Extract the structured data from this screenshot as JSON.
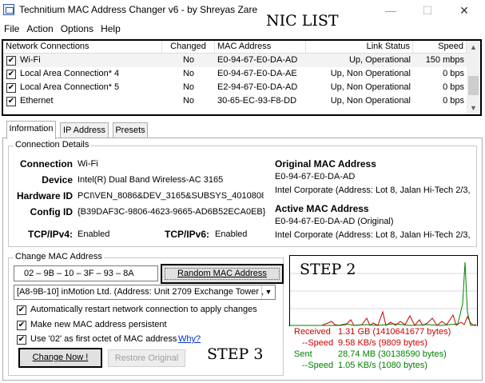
{
  "window": {
    "title": "Technitium MAC Address Changer v6 - by Shreyas Zare",
    "minimize_glyph": "—",
    "maximize_glyph": "☐",
    "close_glyph": "✕"
  },
  "annotations": {
    "nic_list": "NIC LIST",
    "step2": "STEP 2",
    "step3": "STEP 3"
  },
  "menu": [
    "File",
    "Action",
    "Options",
    "Help"
  ],
  "nic_list": {
    "headers": [
      "Network Connections",
      "Changed",
      "MAC Address",
      "Link Status",
      "Speed"
    ],
    "rows": [
      {
        "checked": "✔",
        "name": "Wi-Fi",
        "changed": "No",
        "mac": "E0-94-67-E0-DA-AD",
        "status": "Up, Operational",
        "speed": "150 mbps"
      },
      {
        "checked": "✔",
        "name": "Local Area Connection* 4",
        "changed": "No",
        "mac": "E0-94-67-E0-DA-AE",
        "status": "Up, Non Operational",
        "speed": "0 bps"
      },
      {
        "checked": "✔",
        "name": "Local Area Connection* 5",
        "changed": "No",
        "mac": "E2-94-67-E0-DA-AD",
        "status": "Up, Non Operational",
        "speed": "0 bps"
      },
      {
        "checked": "✔",
        "name": "Ethernet",
        "changed": "No",
        "mac": "30-65-EC-93-F8-DD",
        "status": "Up, Non Operational",
        "speed": "0 bps"
      }
    ],
    "scroll_up": "▲",
    "scroll_down": "▼"
  },
  "tabs": [
    "Information",
    "IP Address",
    "Presets"
  ],
  "connection_details": {
    "title": "Connection Details",
    "connection_label": "Connection",
    "connection": "Wi-Fi",
    "device_label": "Device",
    "device": "Intel(R) Dual Band Wireless-AC 3165",
    "hardware_id_label": "Hardware ID",
    "hardware_id": "PCI\\VEN_8086&DEV_3165&SUBSYS_4010808",
    "config_id_label": "Config ID",
    "config_id": "{B39DAF3C-9806-4623-9665-AD6B52ECA0EB}",
    "tcpipv4_label": "TCP/IPv4:",
    "tcpipv4": "Enabled",
    "tcpipv6_label": "TCP/IPv6:",
    "tcpipv6": "Enabled",
    "original_mac_title": "Original MAC Address",
    "original_mac": "E0-94-67-E0-DA-AD",
    "original_vendor": "Intel Corporate  (Address: Lot 8, Jalan Hi-Tech 2/3,",
    "active_mac_title": "Active MAC Address",
    "active_mac": "E0-94-67-E0-DA-AD (Original)",
    "active_vendor": "Intel Corporate  (Address: Lot 8, Jalan Hi-Tech 2/3,"
  },
  "change_mac": {
    "title": "Change MAC Address",
    "mac_value": "02  –  9B  –  10  –  3F  –  93  –  8A",
    "random_button": "Random MAC Address",
    "vendor_select": "[A8-9B-10] inMotion Ltd.  (Address: Unit 2709 Exchange Tower ,",
    "select_arrow": "▼",
    "options": [
      {
        "checked": "✔",
        "label": "Automatically restart network connection to apply changes"
      },
      {
        "checked": "✔",
        "label": "Make new MAC address persistent"
      },
      {
        "checked": "✔",
        "label": "Use '02' as first octet of MAC address"
      }
    ],
    "why_link": "Why?",
    "change_button": "Change Now !",
    "restore_button": "Restore Original"
  },
  "stats": {
    "received_label": "Received",
    "received": "1.31 GB (1410641677 bytes)",
    "recv_speed_label": "--Speed",
    "recv_speed": "9.58 KB/s (9809 bytes)",
    "sent_label": "Sent",
    "sent": "28.74 MB (30138590 bytes)",
    "sent_speed_label": "--Speed",
    "sent_speed": "1.05 KB/s (1080 bytes)",
    "received_color": "#cc0000",
    "sent_color": "#008000"
  }
}
